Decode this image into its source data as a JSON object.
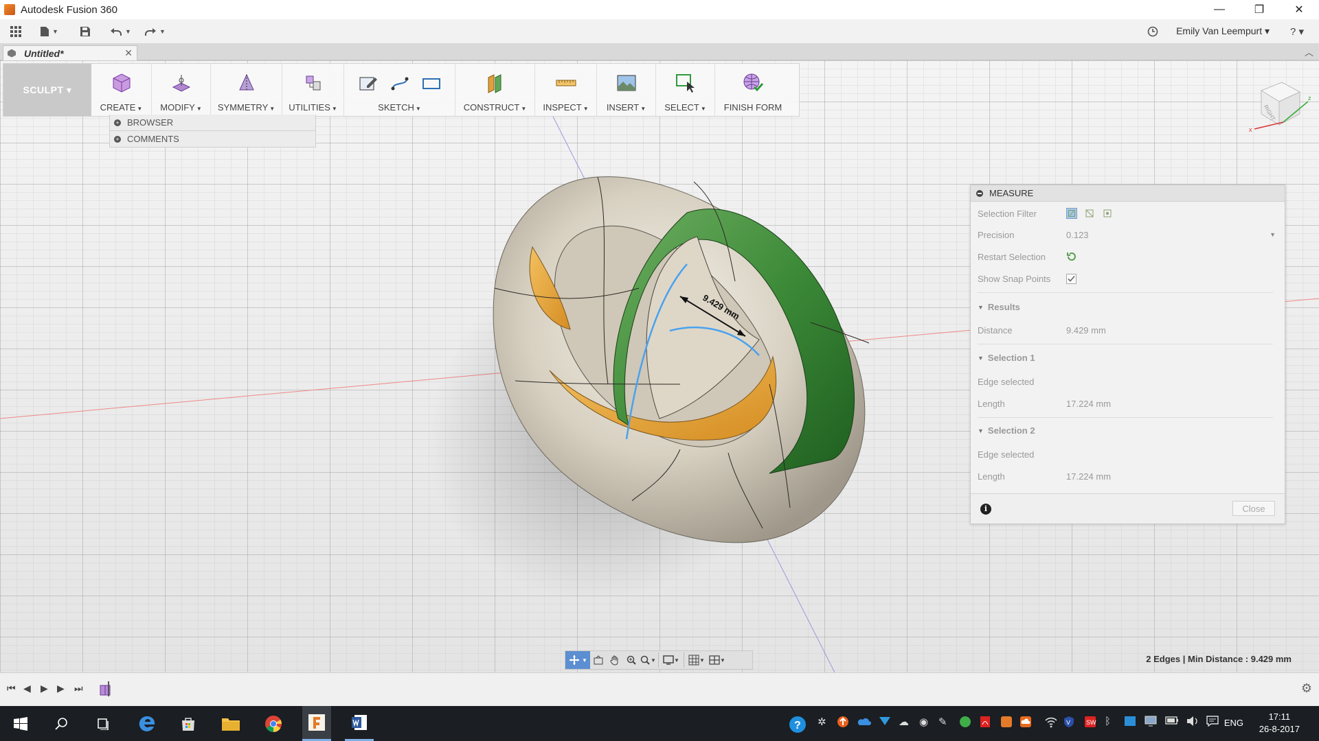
{
  "window": {
    "title": "Autodesk Fusion 360",
    "minimize": "—",
    "restore": "❐",
    "close": "✕"
  },
  "qat": {
    "user": "Emily Van Leempurt ▾",
    "help": "? ▾"
  },
  "document_tab": {
    "title": "Untitled*",
    "close": "✕"
  },
  "ribbon": {
    "workspace": "SCULPT ▾",
    "groups": [
      "CREATE",
      "MODIFY",
      "SYMMETRY",
      "UTILITIES",
      "SKETCH",
      "CONSTRUCT",
      "INSPECT",
      "INSERT",
      "SELECT",
      "FINISH FORM"
    ]
  },
  "panels": {
    "browser": "BROWSER",
    "comments": "COMMENTS"
  },
  "viewcube": {
    "face": "RIGHT"
  },
  "measure_dialog": {
    "title": "MEASURE",
    "selection_filter_label": "Selection Filter",
    "precision_label": "Precision",
    "precision_value": "0.123",
    "restart_selection_label": "Restart Selection",
    "show_snap_points_label": "Show Snap Points",
    "results_header": "Results",
    "distance_label": "Distance",
    "distance_value": "9.429 mm",
    "selection1_header": "Selection 1",
    "selection1_type": "Edge selected",
    "selection1_length_label": "Length",
    "selection1_length_value": "17.224 mm",
    "selection2_header": "Selection 2",
    "selection2_type": "Edge selected",
    "selection2_length_label": "Length",
    "selection2_length_value": "17.224 mm",
    "close_button": "Close"
  },
  "canvas": {
    "dimension_label": "9.429 mm"
  },
  "status_bar": {
    "text": "2 Edges | Min Distance : 9.429 mm"
  },
  "taskbar": {
    "language": "ENG",
    "time": "17:11",
    "date": "26-8-2017"
  },
  "colors": {
    "accent_blue": "#5b8fd1",
    "green_face": "#3e8a3c",
    "orange_face": "#e3a23a",
    "body_surface": "#d9d2c4"
  }
}
